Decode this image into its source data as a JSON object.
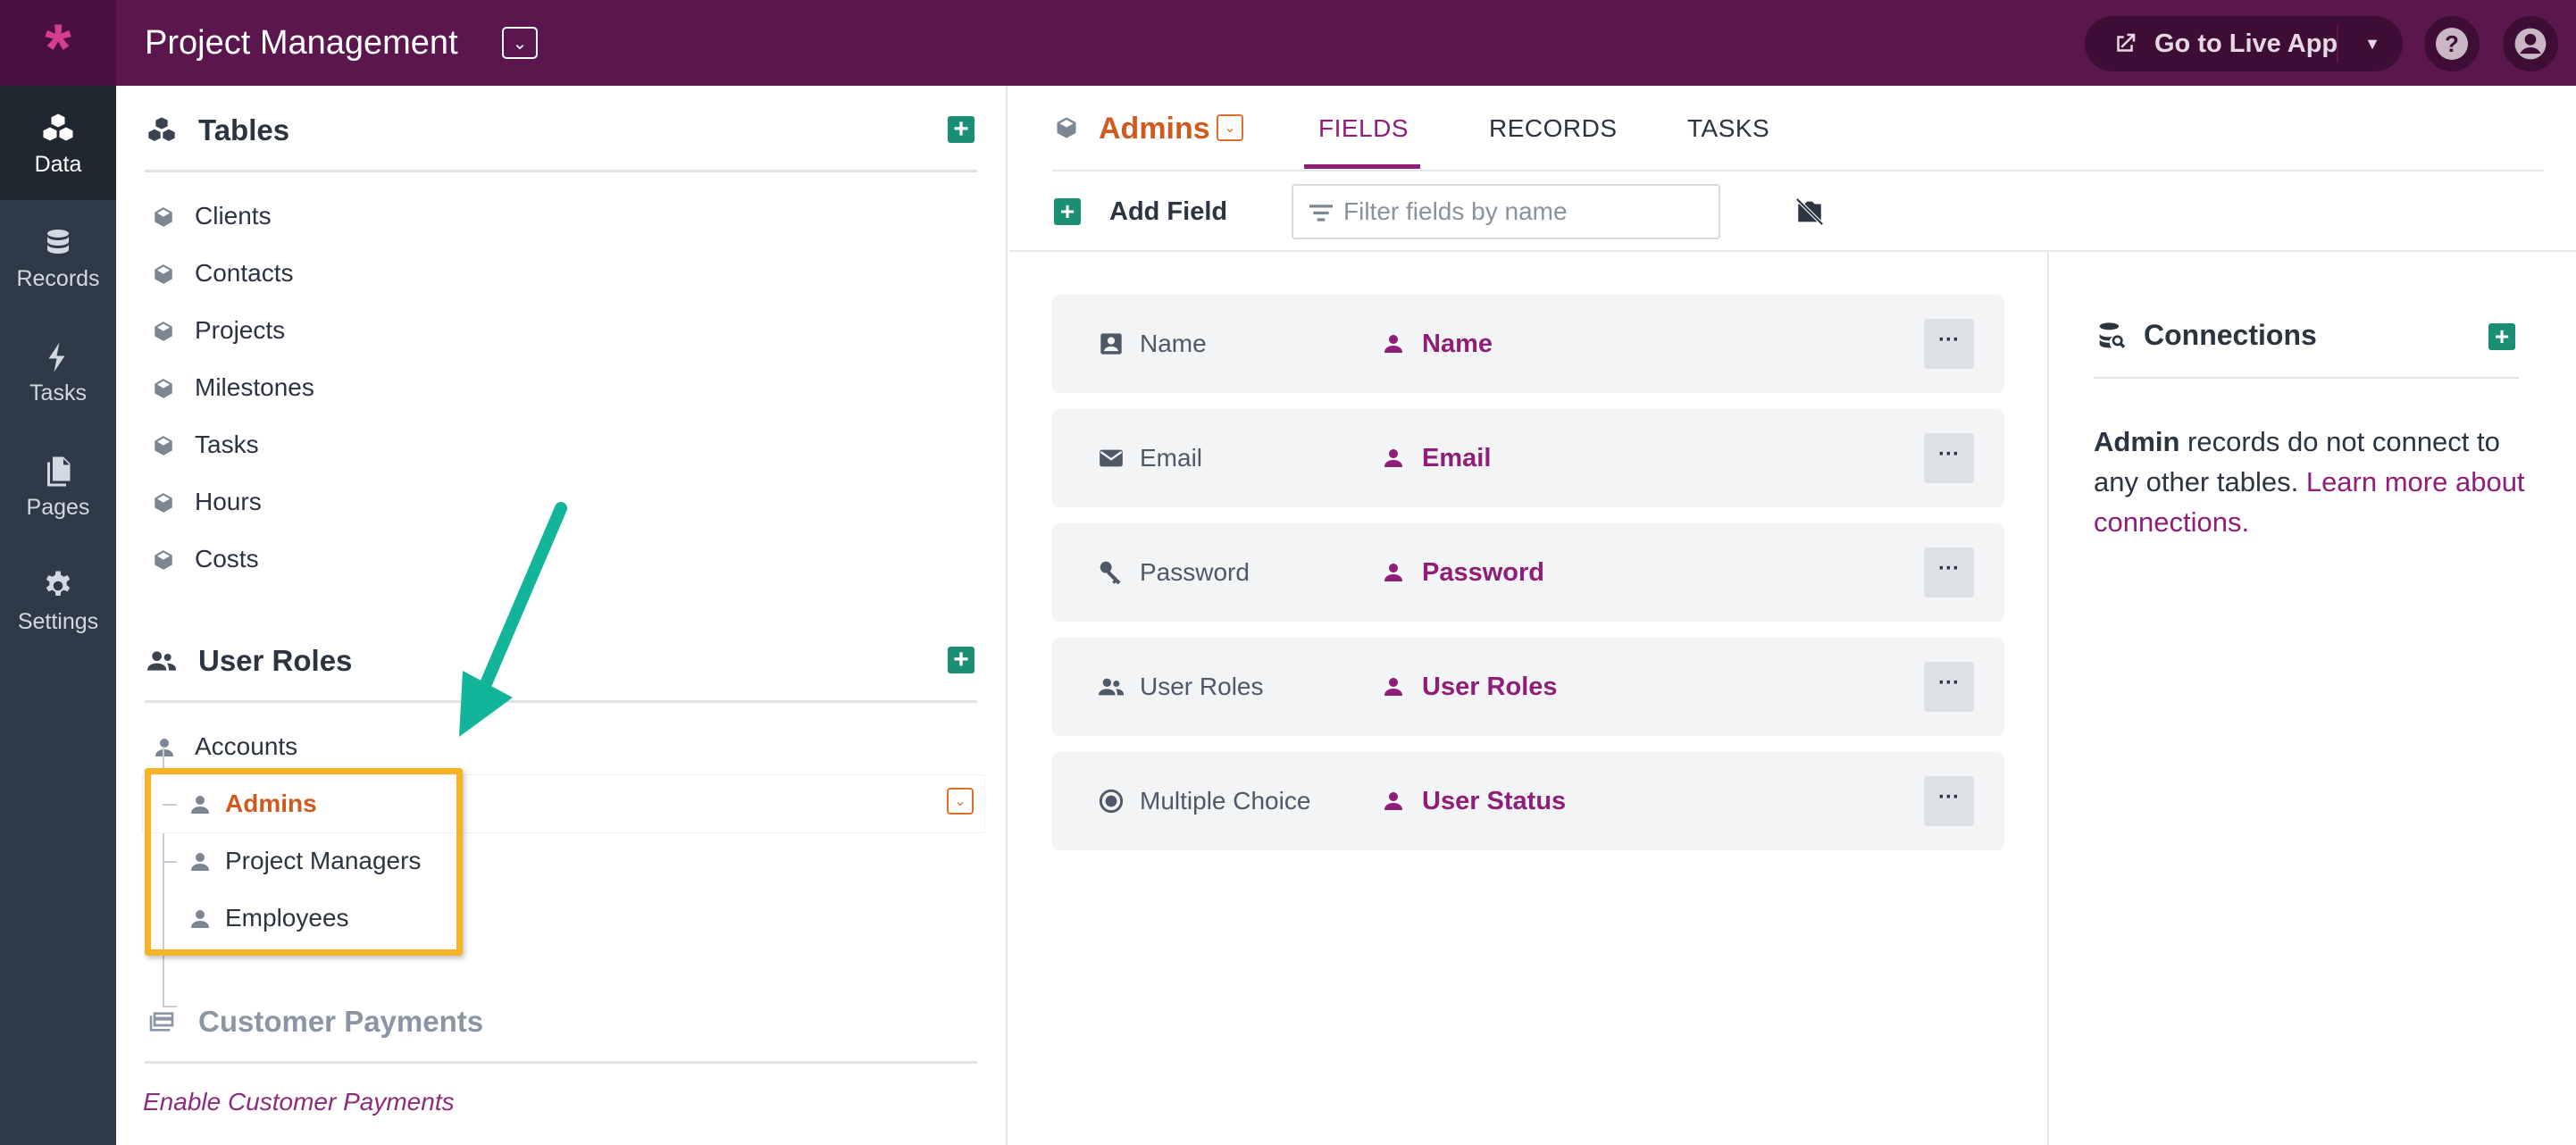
{
  "topbar": {
    "logo": "*",
    "app_title": "Project Management",
    "go_live_label": "Go to Live App",
    "help_label": "?"
  },
  "leftnav": {
    "items": [
      {
        "label": "Data",
        "icon": "cubes-icon",
        "active": true
      },
      {
        "label": "Records",
        "icon": "database-icon"
      },
      {
        "label": "Tasks",
        "icon": "bolt-icon"
      },
      {
        "label": "Pages",
        "icon": "pages-icon"
      },
      {
        "label": "Settings",
        "icon": "gear-icon"
      }
    ]
  },
  "tables": {
    "title": "Tables",
    "items": [
      "Clients",
      "Contacts",
      "Projects",
      "Milestones",
      "Tasks",
      "Hours",
      "Costs"
    ]
  },
  "user_roles": {
    "title": "User Roles",
    "items": [
      "Accounts",
      "Admins",
      "Project Managers",
      "Employees"
    ],
    "selected": "Admins"
  },
  "customer_payments": {
    "title": "Customer Payments",
    "link": "Enable Customer Payments"
  },
  "main": {
    "table_title": "Admins",
    "tabs": [
      "FIELDS",
      "RECORDS",
      "TASKS"
    ],
    "active_tab": "FIELDS",
    "add_field_label": "Add Field",
    "filter_placeholder": "Filter fields by name",
    "more_label": "···",
    "fields": [
      {
        "type": "Name",
        "name": "Name",
        "icon": "id-card-icon"
      },
      {
        "type": "Email",
        "name": "Email",
        "icon": "envelope-icon"
      },
      {
        "type": "Password",
        "name": "Password",
        "icon": "key-icon"
      },
      {
        "type": "User Roles",
        "name": "User Roles",
        "icon": "users-icon"
      },
      {
        "type": "Multiple Choice",
        "name": "User Status",
        "icon": "radio-icon"
      }
    ]
  },
  "connections": {
    "title": "Connections",
    "text_bold": "Admin",
    "text_rest": " records do not connect to any other tables. ",
    "link": "Learn more about connections."
  },
  "colors": {
    "brand": "#5c164e",
    "accent_purple": "#8e1e7a",
    "accent_orange": "#d05a1e",
    "add_green": "#1a8f73",
    "highlight": "#f5b428",
    "arrow": "#12b59a"
  }
}
